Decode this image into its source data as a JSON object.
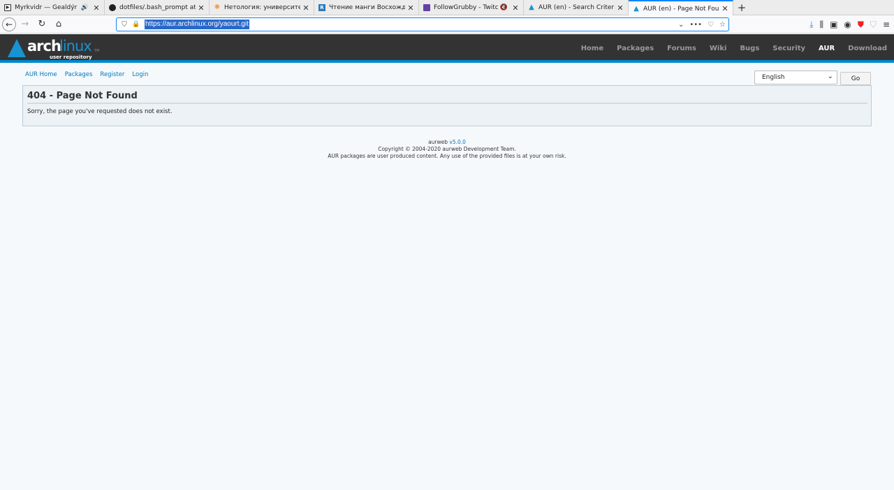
{
  "browser": {
    "tabs": [
      {
        "title": "Myrkvidr — Gealdýr",
        "icon": "play-icon",
        "media": "🔊",
        "active": false
      },
      {
        "title": "dotfiles/.bash_prompt at m",
        "icon": "github-icon",
        "active": false
      },
      {
        "title": "Нетология: университет и",
        "icon": "netology-icon",
        "active": false
      },
      {
        "title": "Чтение манги Восхожден",
        "icon": "readmanga-icon",
        "active": false
      },
      {
        "title": "FollowGrubby - Twitch",
        "icon": "twitch-icon",
        "media": "✕",
        "active": false
      },
      {
        "title": "AUR (en) - Search Criteria: y",
        "icon": "arch-icon",
        "active": false
      },
      {
        "title": "AUR (en) - Page Not Found",
        "icon": "arch-icon",
        "active": true
      }
    ],
    "url": "https://aur.archlinux.org/yaourt.git"
  },
  "arch": {
    "logo_arch": "arch",
    "logo_linux": "linux",
    "logo_tm": "TM",
    "logo_sub": "user repository",
    "menu": [
      "Home",
      "Packages",
      "Forums",
      "Wiki",
      "Bugs",
      "Security",
      "AUR",
      "Download"
    ],
    "menu_selected": "AUR"
  },
  "subnav": [
    "AUR Home",
    "Packages",
    "Register",
    "Login"
  ],
  "language": {
    "selected": "English",
    "go_label": "Go"
  },
  "content": {
    "heading": "404 - Page Not Found",
    "message": "Sorry, the page you've requested does not exist."
  },
  "footer": {
    "aurweb": "aurweb",
    "version": "v5.0.0",
    "copyright": "Copyright © 2004-2020 aurweb Development Team.",
    "disclaimer": "AUR packages are user produced content. Any use of the provided files is at your own risk."
  },
  "colors": {
    "arch_blue": "#1793d1",
    "link": "#0077bb",
    "header_bg": "#333333",
    "focus_blue": "#0a84ff"
  }
}
